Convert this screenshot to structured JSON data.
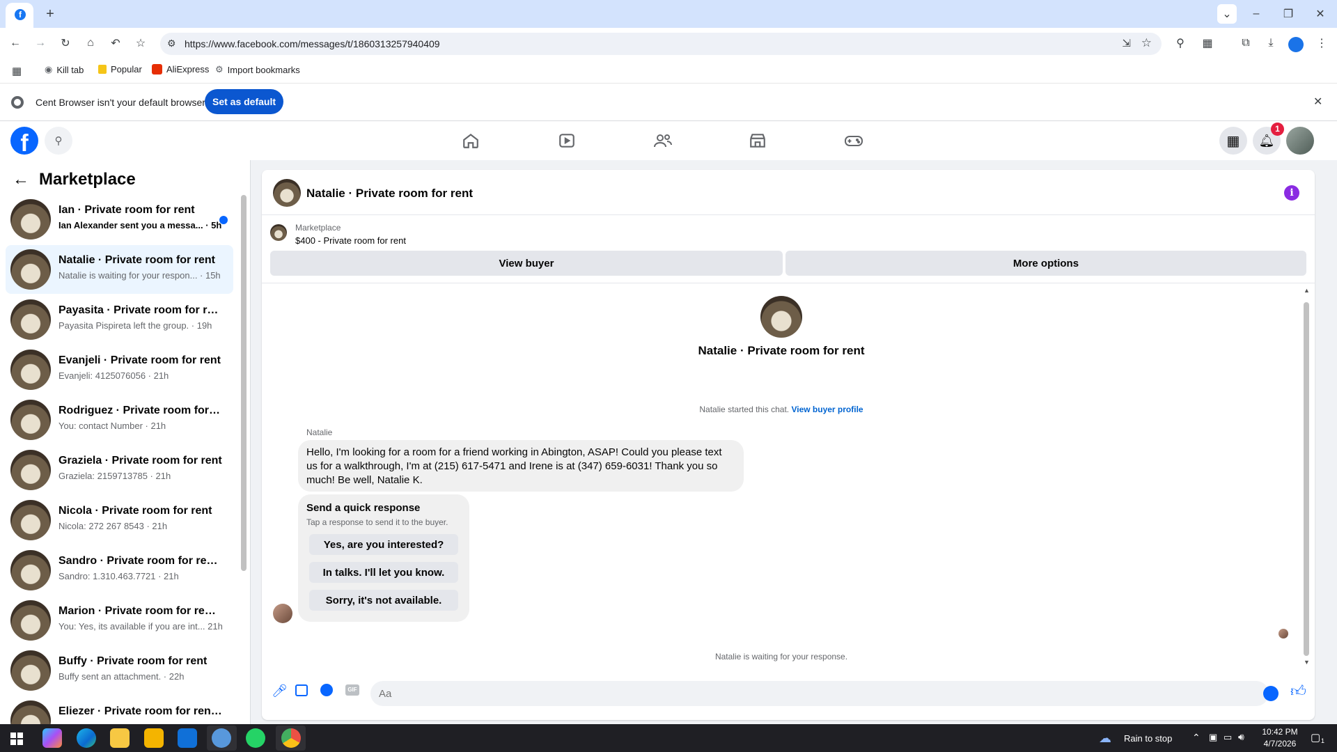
{
  "browser": {
    "url": "https://www.facebook.com/messages/t/1860313257940409",
    "bookmarks": [
      {
        "label": "Kill tab"
      },
      {
        "label": "Popular"
      },
      {
        "label": "AliExpress"
      },
      {
        "label": "Import bookmarks"
      }
    ],
    "infobar": {
      "text": "Cent Browser isn't your default browser",
      "button": "Set as default"
    }
  },
  "fbnav": {
    "notification_count": "1"
  },
  "sidebar": {
    "title": "Marketplace",
    "conversations": [
      {
        "title": "Ian · Private room for rent",
        "preview": "Ian Alexander sent you a messa... · 5h",
        "unread": true
      },
      {
        "title": "Natalie · Private room for rent",
        "preview": "Natalie is waiting for your respon... · 15h",
        "active": true
      },
      {
        "title": "Payasita · Private room for rent ...",
        "preview": "Payasita Pispireta left the group. · 19h"
      },
      {
        "title": "Evanjeli · Private room for rent",
        "preview": "Evanjeli: 4125076056 · 21h"
      },
      {
        "title": "Rodriguez · Private room for r...",
        "preview": "You: contact Number · 21h"
      },
      {
        "title": "Graziela · Private room for rent",
        "preview": "Graziela: 2159713785 · 21h"
      },
      {
        "title": "Nicola · Private room for rent",
        "preview": "Nicola: 272 267 8543 · 21h"
      },
      {
        "title": "Sandro · Private room for rent 1 ...",
        "preview": "Sandro: 1.310.463.7721 · 21h"
      },
      {
        "title": "Marion · Private room for rent 1 ...",
        "preview": "You: Yes, its available if you are int... 21h"
      },
      {
        "title": "Buffy · Private room for rent",
        "preview": "Buffy sent an attachment. · 22h"
      },
      {
        "title": "Eliezer · Private room for rent 1 ...",
        "preview": ""
      }
    ]
  },
  "chat": {
    "header_title": "Natalie · Private room for rent",
    "listing_source": "Marketplace",
    "listing_text": "$400 - Private room for rent",
    "view_buyer": "View buyer",
    "more_options": "More options",
    "intro_title": "Natalie · Private room for rent",
    "started_text": "Natalie started this chat.",
    "view_profile_link": "View buyer profile",
    "sender_name": "Natalie",
    "message": "Hello, I'm looking for a room for a friend working in Abington, ASAP!  Could you please text us for a walkthrough, I'm at (215) 617-5471 and Irene is at (347) 659-6031!  Thank you so much!  Be well,  Natalie K.",
    "quick_title": "Send a quick response",
    "quick_sub": "Tap a response to send it to the buyer.",
    "quick_responses": [
      "Yes, are you interested?",
      "In talks. I'll let you know.",
      "Sorry, it's not available."
    ],
    "waiting_text": "Natalie is waiting for your response.",
    "composer_placeholder": "Aa"
  },
  "taskbar": {
    "weather": "Rain to stop",
    "time": "10:42 PM",
    "date": "4/7/2026",
    "notif_count": "1"
  }
}
